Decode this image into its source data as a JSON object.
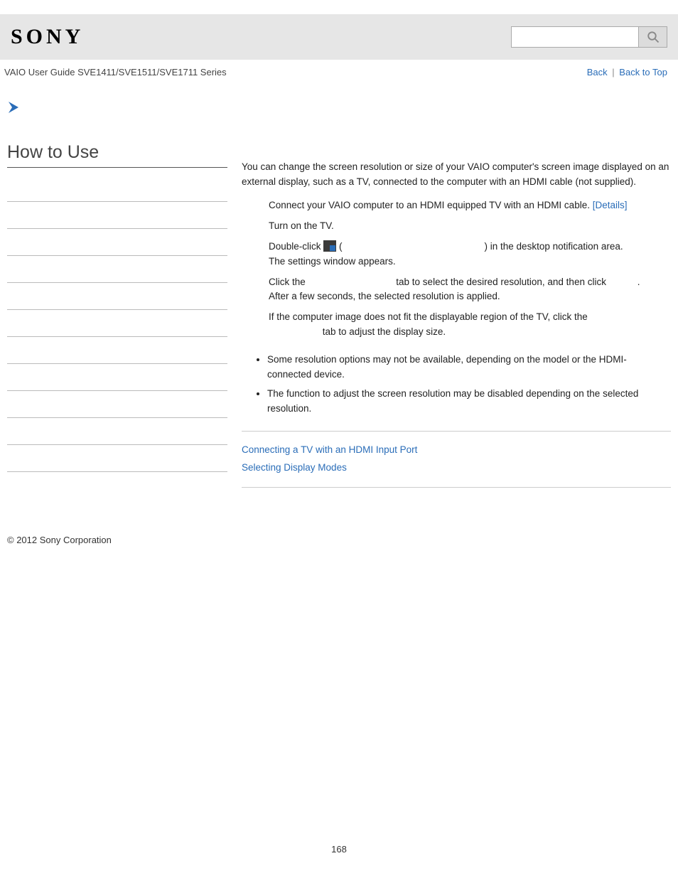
{
  "logo": "SONY",
  "guide_title": "VAIO User Guide SVE1411/SVE1511/SVE1711 Series",
  "nav": {
    "back": "Back",
    "top": "Back to Top"
  },
  "sidebar": {
    "heading": "How to Use"
  },
  "main": {
    "intro": "You can change the screen resolution or size of your VAIO computer's screen image displayed on an external display, such as a TV, connected to the computer with an HDMI cable (not supplied).",
    "step1_prefix": "Connect your VAIO computer to an HDMI equipped TV with an HDMI cable. ",
    "step1_link": "[Details]",
    "step2": "Turn on the TV.",
    "step3_a": "Double-click ",
    "step3_b": " (",
    "step3_c": ") in the desktop notification area.",
    "step3_sub": "The settings window appears.",
    "step4_a": "Click the ",
    "step4_b": " tab to select the desired resolution, and then click ",
    "step4_c": ".",
    "step4_sub": "After a few seconds, the selected resolution is applied.",
    "step5_a": "If the computer image does not fit the displayable region of the TV, click the ",
    "step5_b": " tab to adjust the display size.",
    "notes": [
      "Some resolution options may not be available, depending on the model or the HDMI-connected device.",
      "The function to adjust the screen resolution may be disabled depending on the selected resolution."
    ],
    "related": [
      "Connecting a TV with an HDMI Input Port",
      "Selecting Display Modes"
    ]
  },
  "footer": "© 2012 Sony Corporation",
  "page_number": "168"
}
